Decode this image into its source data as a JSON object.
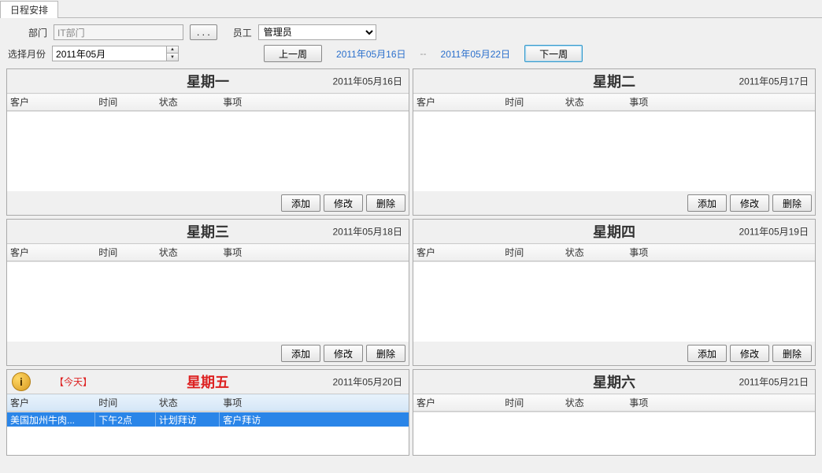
{
  "tab": "日程安排",
  "filters": {
    "dept_label": "部门",
    "dept_value": "IT部门",
    "dept_browse": ". . .",
    "emp_label": "员工",
    "emp_value": "管理员",
    "month_label": "选择月份",
    "month_value": "2011年05月",
    "prev_week": "上一周",
    "date_from": "2011年05月16日",
    "date_sep": "--",
    "date_to": "2011年05月22日",
    "next_week": "下一周"
  },
  "columns": {
    "customer": "客户",
    "time": "时间",
    "status": "状态",
    "item": "事项"
  },
  "actions": {
    "add": "添加",
    "edit": "修改",
    "delete": "删除"
  },
  "today_label": "【今天】",
  "today_icon": "i",
  "days": [
    {
      "title": "星期一",
      "date": "2011年05月16日",
      "rows": [],
      "today": false
    },
    {
      "title": "星期二",
      "date": "2011年05月17日",
      "rows": [],
      "today": false
    },
    {
      "title": "星期三",
      "date": "2011年05月18日",
      "rows": [],
      "today": false
    },
    {
      "title": "星期四",
      "date": "2011年05月19日",
      "rows": [],
      "today": false
    },
    {
      "title": "星期五",
      "date": "2011年05月20日",
      "rows": [
        {
          "customer": "美国加州牛肉...",
          "time": "下午2点",
          "status": "计划拜访",
          "item": "客户拜访"
        }
      ],
      "today": true
    },
    {
      "title": "星期六",
      "date": "2011年05月21日",
      "rows": [],
      "today": false
    }
  ]
}
